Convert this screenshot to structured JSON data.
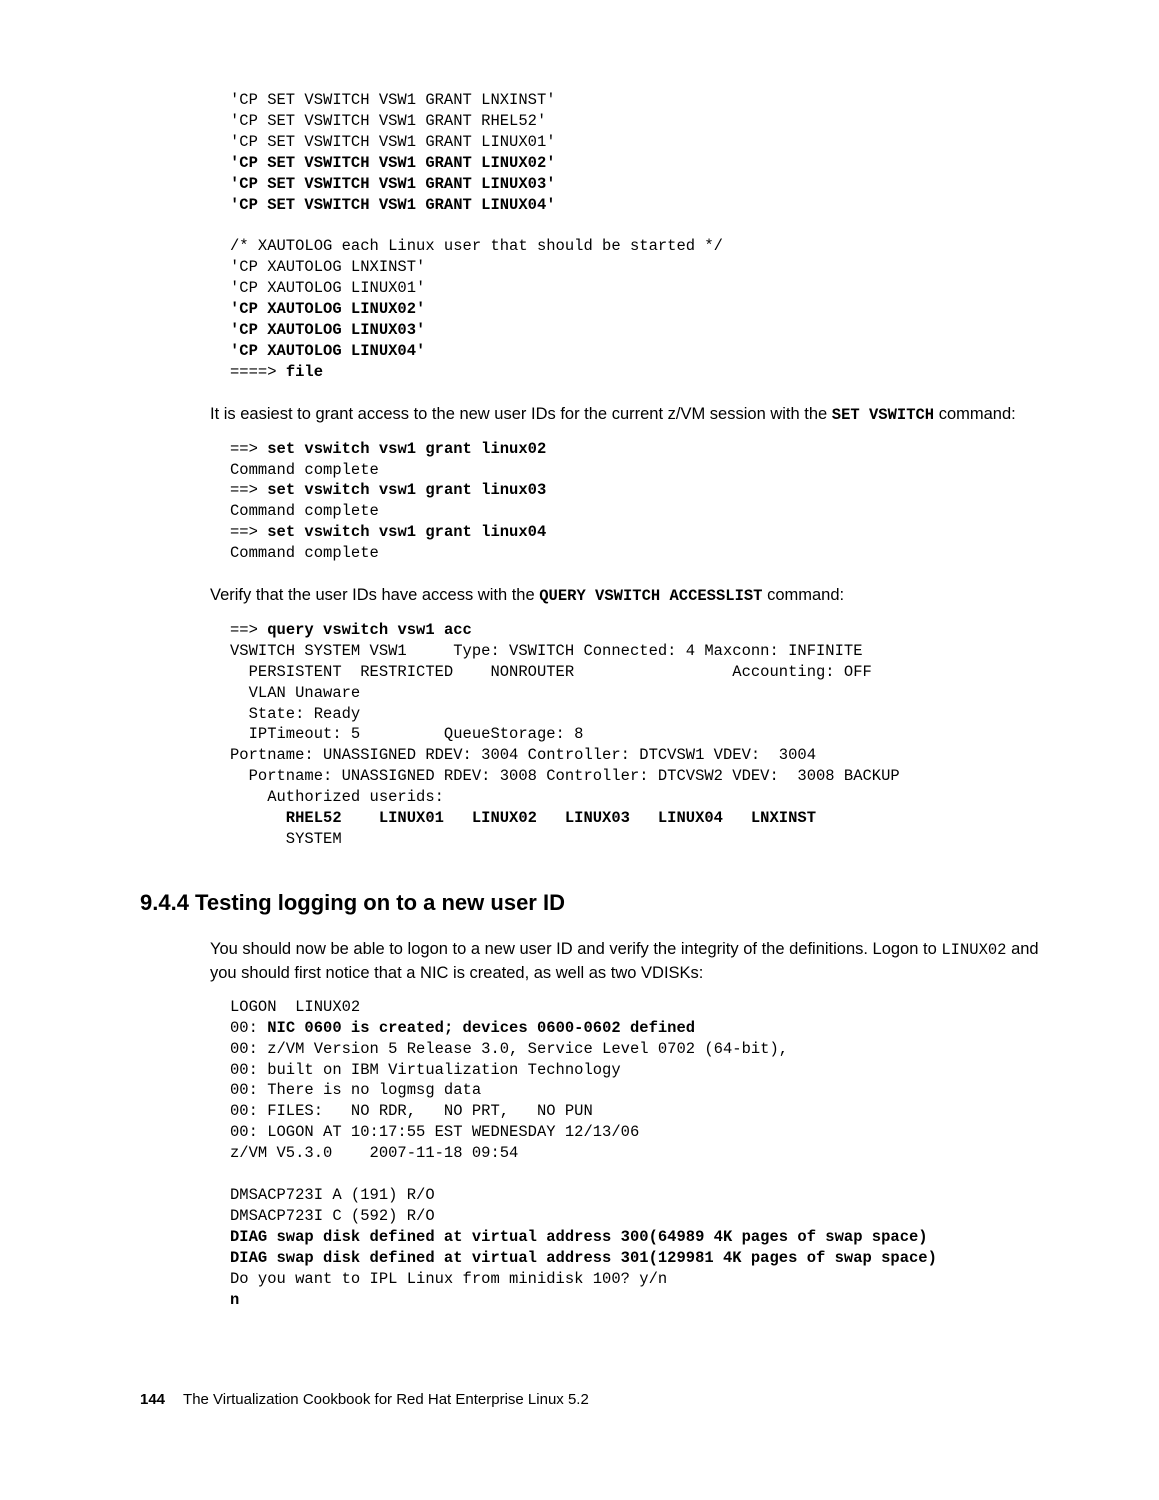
{
  "code1": {
    "l1": "'CP SET VSWITCH VSW1 GRANT LNXINST'",
    "l2": "'CP SET VSWITCH VSW1 GRANT RHEL52'",
    "l3": "'CP SET VSWITCH VSW1 GRANT LINUX01'",
    "l4": "'CP SET VSWITCH VSW1 GRANT LINUX02'",
    "l5": "'CP SET VSWITCH VSW1 GRANT LINUX03'",
    "l6": "'CP SET VSWITCH VSW1 GRANT LINUX04'",
    "l7": "/* XAUTOLOG each Linux user that should be started */",
    "l8": "'CP XAUTOLOG LNXINST'",
    "l9": "'CP XAUTOLOG LINUX01'",
    "l10": "'CP XAUTOLOG LINUX02'",
    "l11": "'CP XAUTOLOG LINUX03'",
    "l12": "'CP XAUTOLOG LINUX04'",
    "l13a": "====> ",
    "l13b": "file"
  },
  "para1": {
    "a": "It is easiest to grant access to the new user IDs for the current z/VM session with the ",
    "b": "SET VSWITCH",
    "c": " command:"
  },
  "code2": {
    "l1a": "==> ",
    "l1b": "set vswitch vsw1 grant linux02",
    "l2": "Command complete",
    "l3a": "==> ",
    "l3b": "set vswitch vsw1 grant linux03",
    "l4": "Command complete",
    "l5a": "==> ",
    "l5b": "set vswitch vsw1 grant linux04",
    "l6": "Command complete"
  },
  "para2": {
    "a": "Verify that the user IDs have access with the ",
    "b": "QUERY VSWITCH ACCESSLIST",
    "c": " command:"
  },
  "code3": {
    "l1a": "==> ",
    "l1b": "query vswitch vsw1 acc",
    "l2": "VSWITCH SYSTEM VSW1     Type: VSWITCH Connected: 4 Maxconn: INFINITE",
    "l3": "  PERSISTENT  RESTRICTED    NONROUTER                 Accounting: OFF",
    "l4": "  VLAN Unaware",
    "l5": "  State: Ready",
    "l6": "  IPTimeout: 5         QueueStorage: 8",
    "l7": "Portname: UNASSIGNED RDEV: 3004 Controller: DTCVSW1 VDEV:  3004",
    "l8": "  Portname: UNASSIGNED RDEV: 3008 Controller: DTCVSW2 VDEV:  3008 BACKUP",
    "l9": "    Authorized userids:",
    "l10": "      RHEL52    LINUX01   LINUX02   LINUX03   LINUX04   LNXINST",
    "l11": "      SYSTEM"
  },
  "heading": "9.4.4  Testing logging on to a new user ID",
  "para3": {
    "a": "You should now be able to logon to a new user ID and verify the integrity of the definitions. Logon to ",
    "b": "LINUX02",
    "c": " and you should first notice that a NIC is created, as well as two VDISKs:"
  },
  "code4": {
    "l1": "LOGON  LINUX02",
    "l2a": "00: ",
    "l2b": "NIC 0600 is created; devices 0600-0602 defined",
    "l3": "00: z/VM Version 5 Release 3.0, Service Level 0702 (64-bit),",
    "l4": "00: built on IBM Virtualization Technology",
    "l5": "00: There is no logmsg data",
    "l6": "00: FILES:   NO RDR,   NO PRT,   NO PUN",
    "l7": "00: LOGON AT 10:17:55 EST WEDNESDAY 12/13/06",
    "l8": "z/VM V5.3.0    2007-11-18 09:54",
    "l9": "",
    "l10": "DMSACP723I A (191) R/O",
    "l11": "DMSACP723I C (592) R/O",
    "l12": "DIAG swap disk defined at virtual address 300(64989 4K pages of swap space)",
    "l13": "DIAG swap disk defined at virtual address 301(129981 4K pages of swap space)",
    "l14": "Do you want to IPL Linux from minidisk 100? y/n",
    "l15": "n"
  },
  "footer": {
    "page": "144",
    "title": "The Virtualization Cookbook for Red Hat Enterprise Linux 5.2"
  }
}
